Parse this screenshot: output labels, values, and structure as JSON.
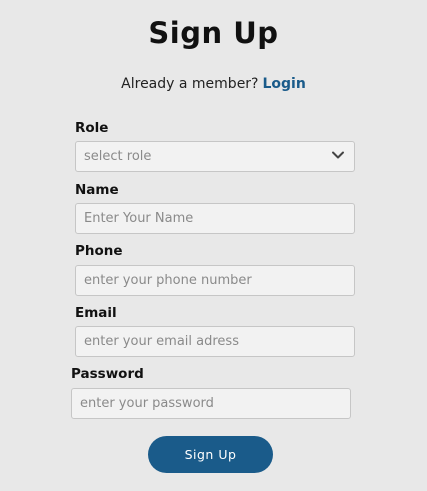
{
  "header": {
    "title": "Sign Up"
  },
  "member": {
    "text": "Already a member?",
    "login_label": "Login"
  },
  "form": {
    "role": {
      "label": "Role",
      "selected": "select role"
    },
    "name": {
      "label": "Name",
      "placeholder": "Enter Your Name"
    },
    "phone": {
      "label": "Phone",
      "placeholder": "enter your phone number"
    },
    "email": {
      "label": "Email",
      "placeholder": "enter your email adress"
    },
    "password": {
      "label": "Password",
      "placeholder": "enter your password"
    },
    "submit_label": "Sign Up"
  },
  "colors": {
    "background": "#e8e8e8",
    "accent": "#1a5b8a",
    "field_background": "#f2f2f2"
  },
  "icons": {
    "role_dropdown": "chevron-down-icon"
  }
}
